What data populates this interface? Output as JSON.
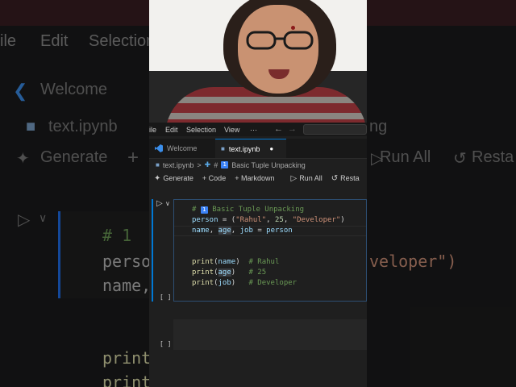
{
  "menu": {
    "file": "ile",
    "edit": "Edit",
    "selection": "Selection",
    "view": "View",
    "more": "···"
  },
  "tabs": [
    {
      "label": "Welcome",
      "icon": "vscode-logo-icon"
    },
    {
      "label": "text.ipynb",
      "icon": "notebook-file-icon",
      "dirty": true
    }
  ],
  "breadcrumb": {
    "file": "text.ipynb",
    "separator": ">",
    "section_number": "1",
    "section": "Basic Tuple Unpacking"
  },
  "toolbar": {
    "generate": "Generate",
    "code": "+ Code",
    "markdown": "+ Markdown",
    "run_all": "Run All",
    "restart": "Resta"
  },
  "cell1": {
    "bracket": "[ ]",
    "lines": {
      "l1_comment": "# ",
      "l1_num": "1",
      "l1_title": " Basic Tuple Unpacking",
      "l2_var": "person",
      "l2_eq": " = (",
      "l2_s1": "\"Rahul\"",
      "l2_c1": ", ",
      "l2_n": "25",
      "l2_c2": ", ",
      "l2_s2": "\"Developer\"",
      "l2_end": ")",
      "l3_a": "name",
      "l3_b": ", ",
      "l3_c": "age",
      "l3_d": ", ",
      "l3_e": "job",
      "l3_f": " = ",
      "l3_g": "person",
      "l6_fn": "print",
      "l6_var": "name",
      "l6_cm": "# Rahul",
      "l7_fn": "print",
      "l7_var": "age",
      "l7_cm": "# 25",
      "l8_fn": "print",
      "l8_var": "job",
      "l8_cm": "# Developer"
    }
  },
  "cell2": {
    "bracket": "[ ]"
  },
  "background": {
    "menu": [
      "ile",
      "Edit",
      "Selection"
    ],
    "welcome": "Welcome",
    "file": "text.ipynb",
    "generate": "Generate",
    "ng": "ng",
    "run_all": "Run All",
    "restart": "Resta",
    "code1": "# 1",
    "code2": "perso",
    "code3": "name,",
    "code4": "veloper\")",
    "code5": "print",
    "code6": "print"
  },
  "colors": {
    "accent": "#0078d4",
    "comment": "#6a9955",
    "string": "#ce9178",
    "number": "#b5cea8",
    "variable": "#9cdcfe",
    "function": "#dcdcaa"
  }
}
